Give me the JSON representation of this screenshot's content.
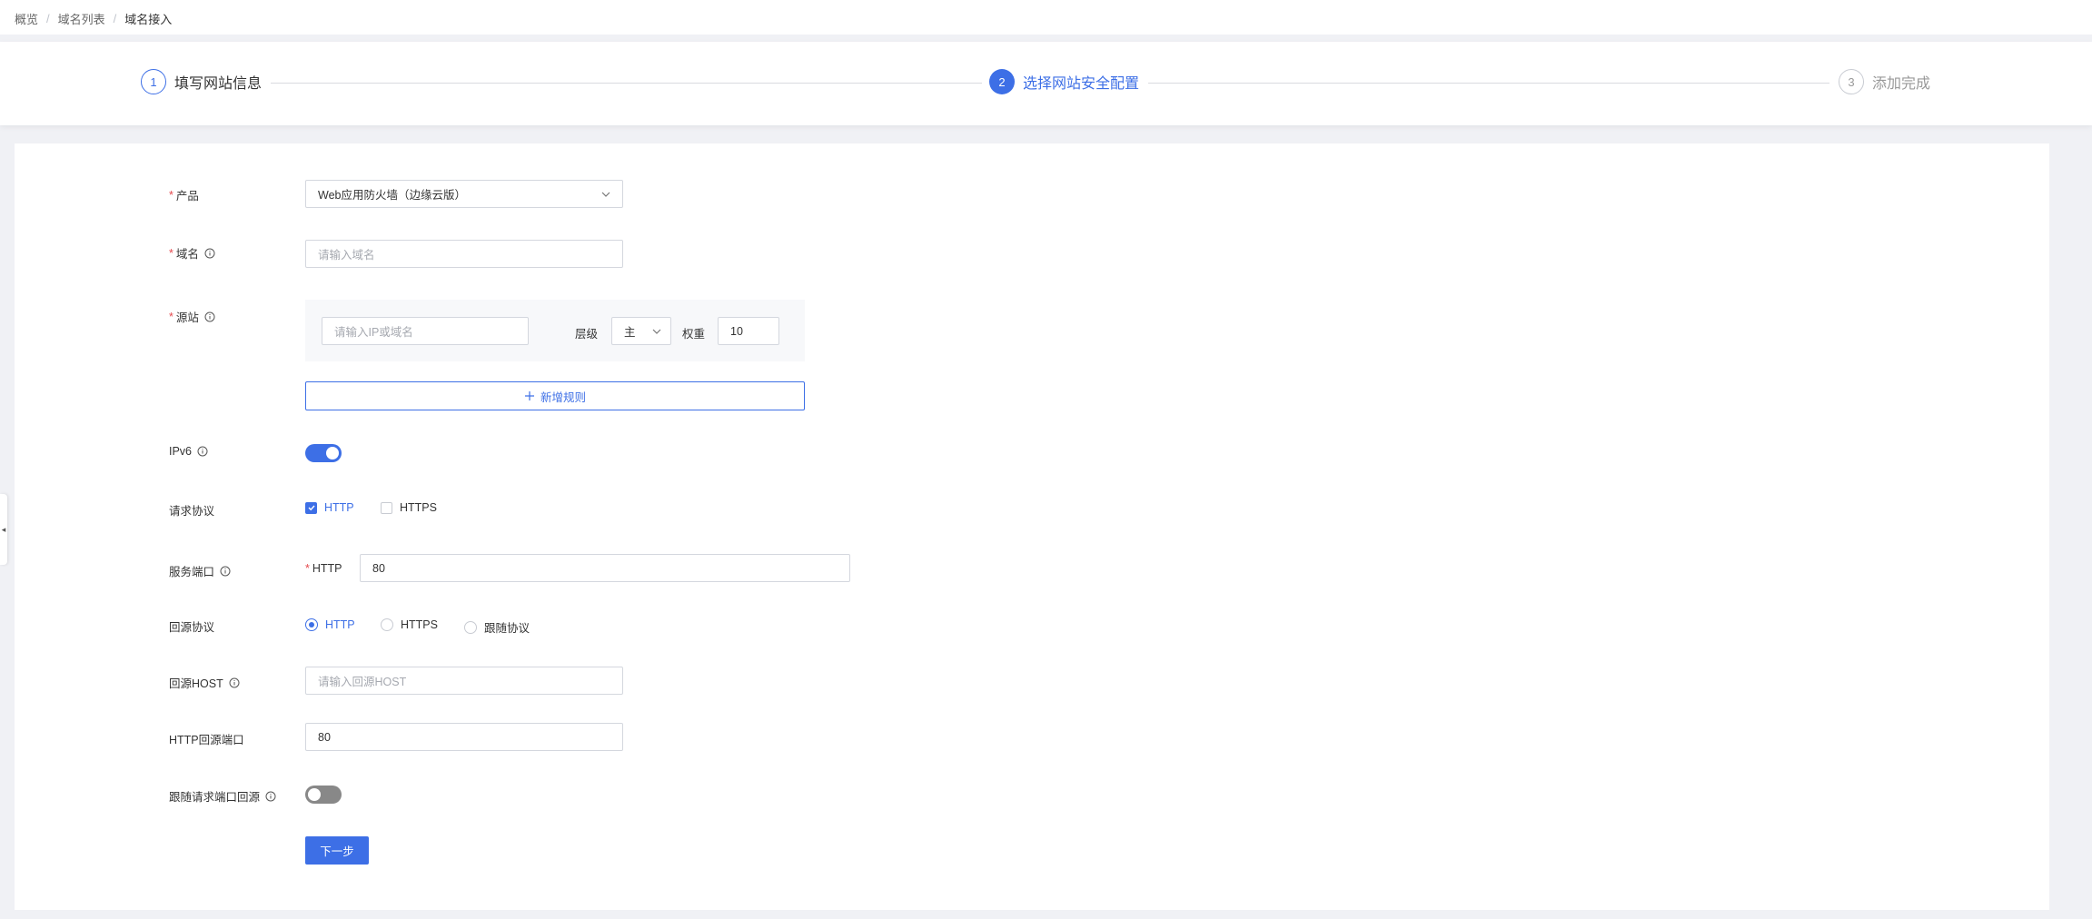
{
  "breadcrumb": [
    "概览",
    "域名列表",
    "域名接入"
  ],
  "steps": [
    {
      "number": "1",
      "title": "填写网站信息",
      "state": "done"
    },
    {
      "number": "2",
      "title": "选择网站安全配置",
      "state": "active"
    },
    {
      "number": "3",
      "title": "添加完成",
      "state": "wait"
    }
  ],
  "form": {
    "product": {
      "label": "产品",
      "value": "Web应用防火墙（边缘云版）"
    },
    "domain": {
      "label": "域名",
      "placeholder": "请输入域名"
    },
    "origin": {
      "label": "源站",
      "ip_placeholder": "请输入IP或域名",
      "level_label": "层级",
      "level_value": "主",
      "weight_label": "权重",
      "weight_value": "10",
      "add_rule_label": "新增规则"
    },
    "ipv6": {
      "label": "IPv6",
      "enabled": true
    },
    "request_protocol": {
      "label": "请求协议",
      "options": [
        {
          "label": "HTTP",
          "checked": true
        },
        {
          "label": "HTTPS",
          "checked": false
        }
      ]
    },
    "service_port": {
      "label": "服务端口",
      "http_label": "HTTP",
      "http_value": "80"
    },
    "origin_protocol": {
      "label": "回源协议",
      "options": [
        "HTTP",
        "HTTPS",
        "跟随协议"
      ],
      "selected": "HTTP"
    },
    "origin_host": {
      "label": "回源HOST",
      "placeholder": "请输入回源HOST"
    },
    "http_origin_port": {
      "label": "HTTP回源端口",
      "value": "80"
    },
    "follow_request_port": {
      "label": "跟随请求端口回源",
      "enabled": false
    },
    "next_button": "下一步"
  },
  "colors": {
    "accent": "#3d6fe6",
    "required": "#e5484d",
    "page_bg": "#f0f1f5"
  }
}
